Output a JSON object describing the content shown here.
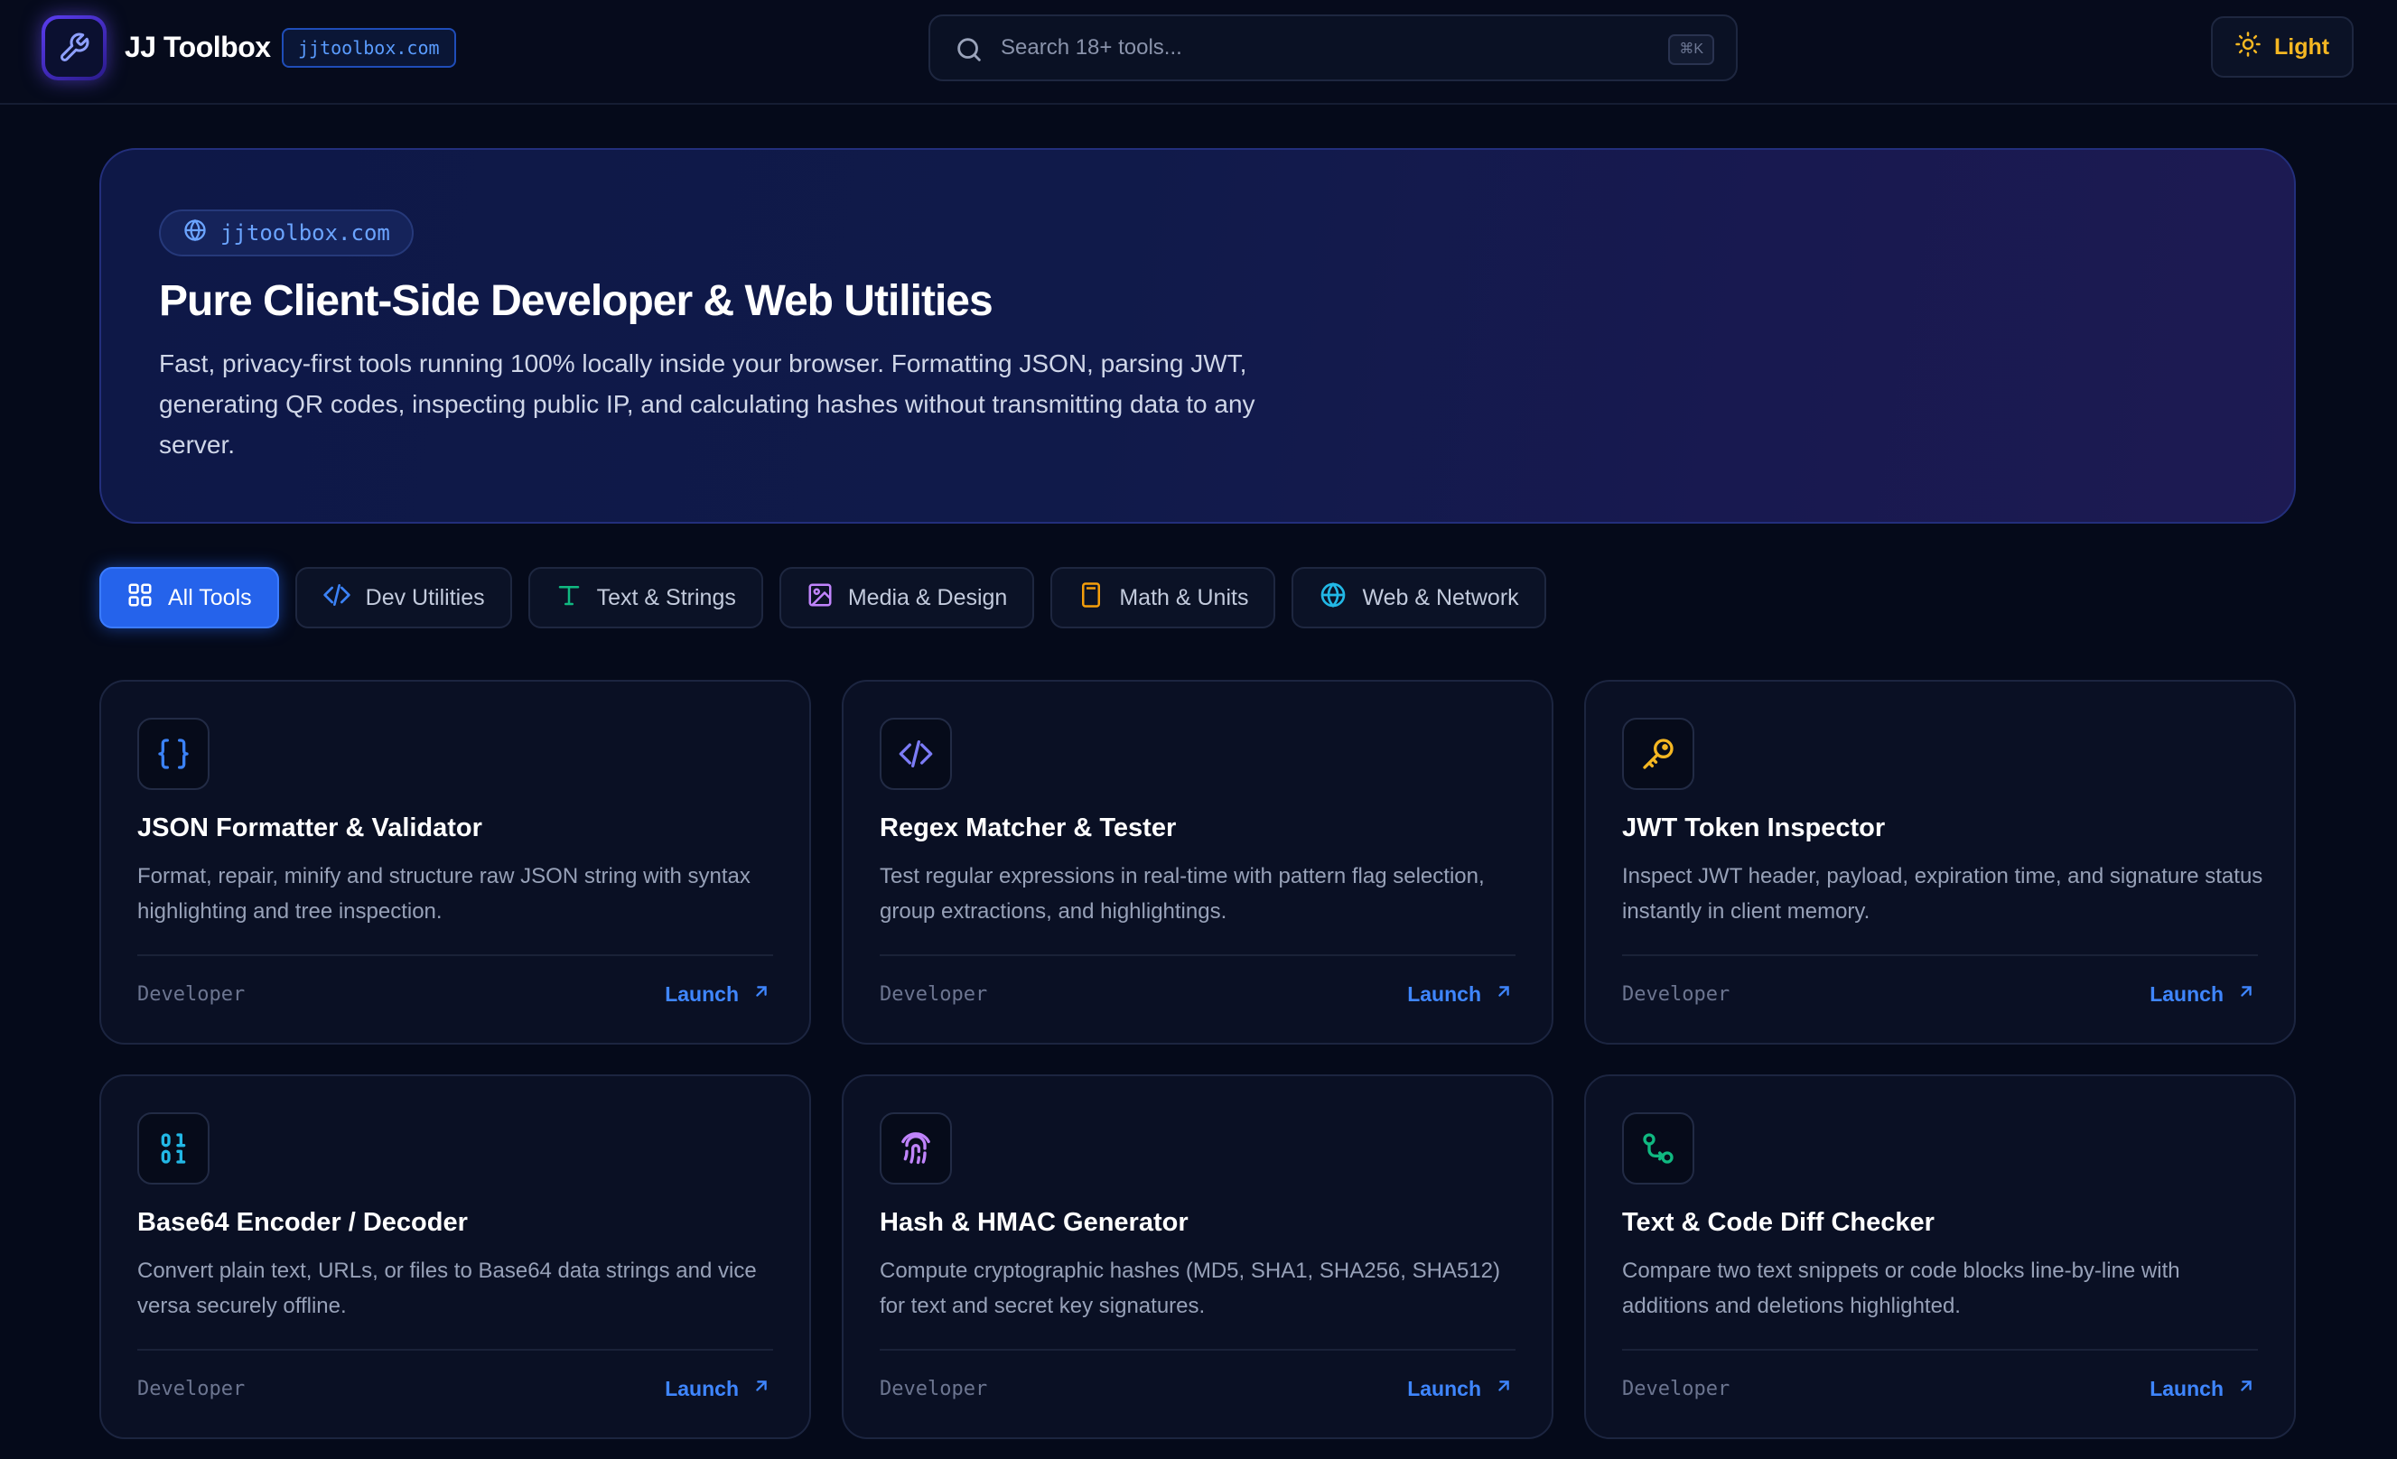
{
  "header": {
    "brand": "JJ Toolbox",
    "domain_badge": "jjtoolbox.com",
    "search_placeholder": "Search 18+ tools...",
    "shortcut": "⌘K",
    "theme_label": "Light"
  },
  "hero": {
    "pill": "jjtoolbox.com",
    "title": "Pure Client-Side Developer & Web Utilities",
    "description": "Fast, privacy-first tools running 100% locally inside your browser. Formatting JSON, parsing JWT, generating QR codes, inspecting public IP, and calculating hashes without transmitting data to any server."
  },
  "tabs": [
    {
      "label": "All Tools",
      "icon": "grid-icon",
      "color": "#ffffff",
      "active": true
    },
    {
      "label": "Dev Utilities",
      "icon": "code-icon",
      "color": "#3b82f6"
    },
    {
      "label": "Text & Strings",
      "icon": "type-icon",
      "color": "#10b981"
    },
    {
      "label": "Media & Design",
      "icon": "image-icon",
      "color": "#c084fc"
    },
    {
      "label": "Math & Units",
      "icon": "calculator-icon",
      "color": "#f59e0b"
    },
    {
      "label": "Web & Network",
      "icon": "globe-icon",
      "color": "#22b8e6"
    }
  ],
  "cards": [
    {
      "title": "JSON Formatter & Validator",
      "description": "Format, repair, minify and structure raw JSON string with syntax highlighting and tree inspection.",
      "category": "Developer",
      "launch": "Launch",
      "icon": "braces-icon",
      "icon_color": "#3b82f6"
    },
    {
      "title": "Regex Matcher & Tester",
      "description": "Test regular expressions in real-time with pattern flag selection, group extractions, and highlightings.",
      "category": "Developer",
      "launch": "Launch",
      "icon": "code-icon",
      "icon_color": "#7c7cf7"
    },
    {
      "title": "JWT Token Inspector",
      "description": "Inspect JWT header, payload, expiration time, and signature status instantly in client memory.",
      "category": "Developer",
      "launch": "Launch",
      "icon": "key-icon",
      "icon_color": "#f5b722"
    },
    {
      "title": "Base64 Encoder / Decoder",
      "description": "Convert plain text, URLs, or files to Base64 data strings and vice versa securely offline.",
      "category": "Developer",
      "launch": "Launch",
      "icon": "binary-icon",
      "icon_color": "#22b8e6"
    },
    {
      "title": "Hash & HMAC Generator",
      "description": "Compute cryptographic hashes (MD5, SHA1, SHA256, SHA512) for text and secret key signatures.",
      "category": "Developer",
      "launch": "Launch",
      "icon": "fingerprint-icon",
      "icon_color": "#c084fc"
    },
    {
      "title": "Text & Code Diff Checker",
      "description": "Compare two text snippets or code blocks line-by-line with additions and deletions highlighted.",
      "category": "Developer",
      "launch": "Launch",
      "icon": "git-compare-icon",
      "icon_color": "#10b981"
    }
  ]
}
